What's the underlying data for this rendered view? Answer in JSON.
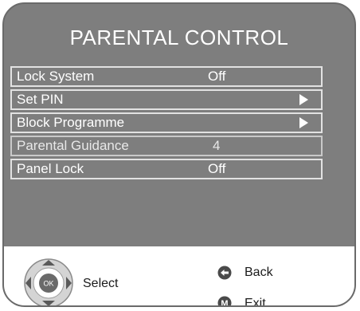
{
  "title": "PARENTAL CONTROL",
  "menu": {
    "items": [
      {
        "label": "Lock System",
        "value": "Off"
      },
      {
        "label": "Set PIN",
        "arrow": "right-arrow-icon"
      },
      {
        "label": "Block Programme",
        "arrow": "right-arrow-icon"
      },
      {
        "label": "Parental Guidance",
        "value": "4"
      },
      {
        "label": "Panel Lock",
        "value": "Off"
      }
    ]
  },
  "footer": {
    "select_label": "Select",
    "ok_label": "OK",
    "back_label": "Back",
    "exit_label": "Exit",
    "exit_key_letter": "M"
  },
  "colors": {
    "panel": "#7e7e7e",
    "row_border": "#e2e2e2",
    "text": "#ffffff",
    "footer_bg": "#ffffff"
  }
}
